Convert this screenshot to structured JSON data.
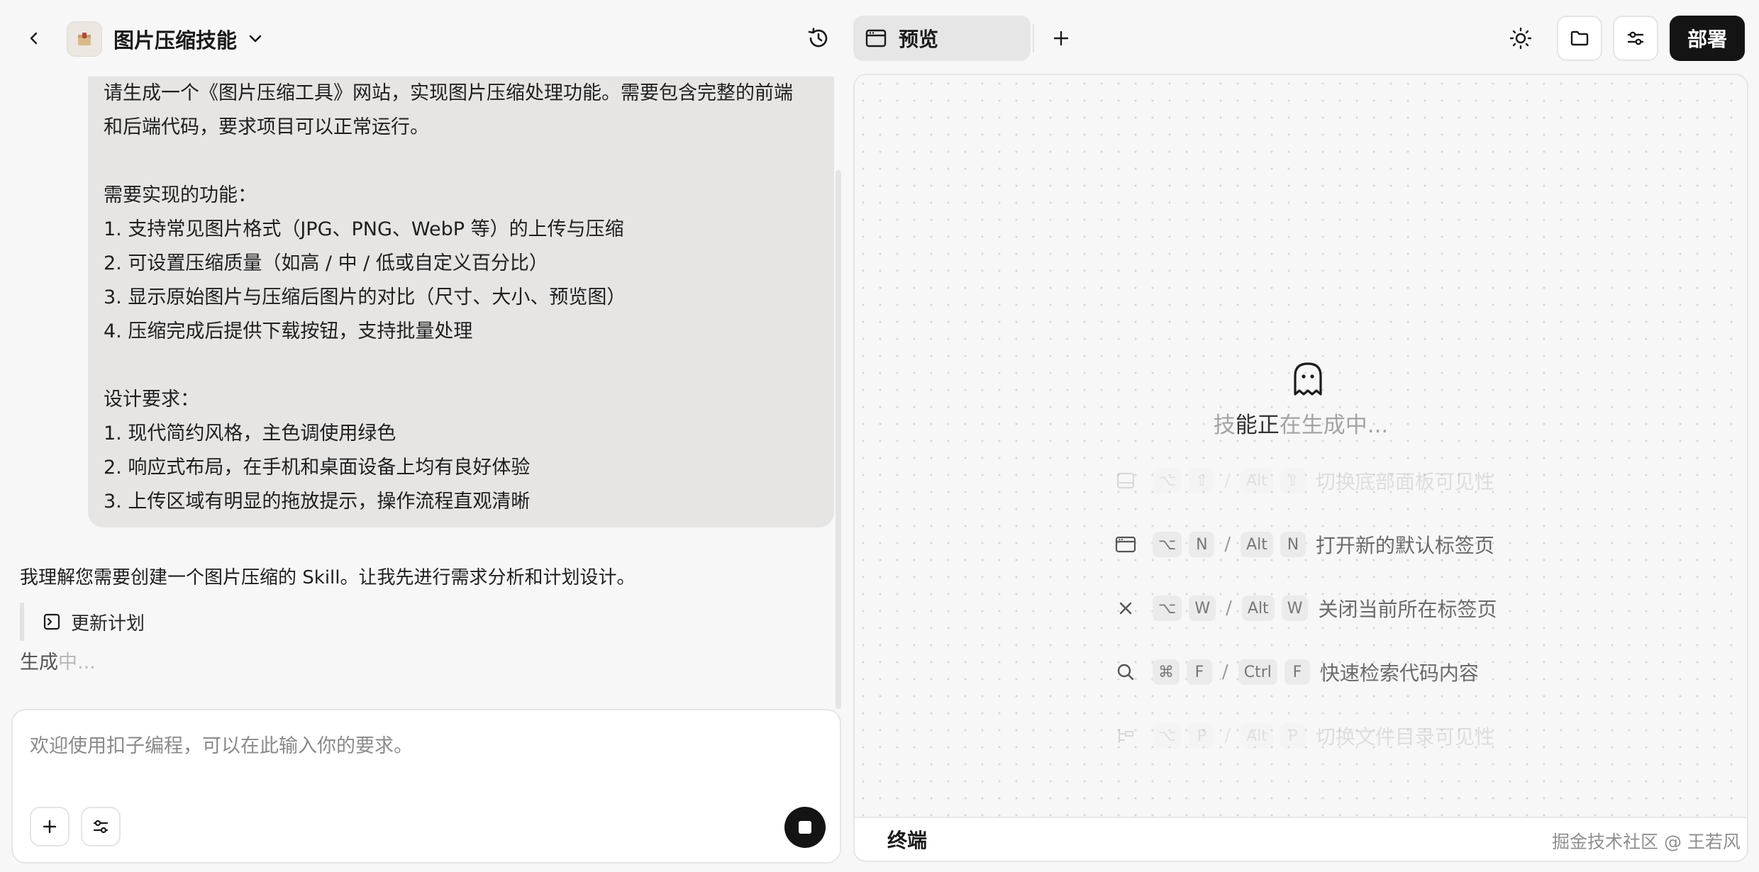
{
  "header": {
    "title": "图片压缩技能",
    "preview_tab_label": "预览",
    "deploy_label": "部署"
  },
  "chat": {
    "user_message_lines": [
      "请生成一个《图片压缩工具》网站，实现图片压缩处理功能。需要包含完整的前端",
      "和后端代码，要求项目可以正常运行。",
      "",
      "需要实现的功能：",
      "1. 支持常见图片格式（JPG、PNG、WebP 等）的上传与压缩",
      "2. 可设置压缩质量（如高 / 中 / 低或自定义百分比）",
      "3. 显示原始图片与压缩后图片的对比（尺寸、大小、预览图）",
      "4. 压缩完成后提供下载按钮，支持批量处理",
      "",
      "设计要求：",
      "1. 现代简约风格，主色调使用绿色",
      "2. 响应式布局，在手机和桌面设备上均有良好体验",
      "3. 上传区域有明显的拖放提示，操作流程直观清晰"
    ],
    "assistant_reply": "我理解您需要创建一个图片压缩的 Skill。让我先进行需求分析和计划设计。",
    "plan_step_label": "更新计划",
    "generating_prefix": "生成",
    "generating_suffix": "中..."
  },
  "input": {
    "placeholder": "欢迎使用扣子编程，可以在此输入你的要求。"
  },
  "preview": {
    "status_prefix": "技",
    "status_emph": "能正",
    "status_suffix": "在生成中...",
    "shortcuts": [
      {
        "icon": "layout-icon",
        "keys_mac": [
          "⌥",
          "⇧"
        ],
        "keys_win": [
          "Alt",
          "⇧"
        ],
        "label": "切换底部面板可见性"
      },
      {
        "icon": "browser-tab-icon",
        "keys_mac": [
          "⌥",
          "N"
        ],
        "keys_win": [
          "Alt",
          "N"
        ],
        "label": "打开新的默认标签页"
      },
      {
        "icon": "close-icon",
        "keys_mac": [
          "⌥",
          "W"
        ],
        "keys_win": [
          "Alt",
          "W"
        ],
        "label": "关闭当前所在标签页"
      },
      {
        "icon": "search-icon",
        "keys_mac": [
          "⌘",
          "F"
        ],
        "keys_win": [
          "Ctrl",
          "F"
        ],
        "label": "快速检索代码内容"
      },
      {
        "icon": "file-tree-icon",
        "keys_mac": [
          "⌥",
          "P"
        ],
        "keys_win": [
          "Alt",
          "P"
        ],
        "label": "切换文件目录可见性"
      }
    ],
    "terminal_label": "终端"
  },
  "watermark": "掘金技术社区 @ 王若风"
}
